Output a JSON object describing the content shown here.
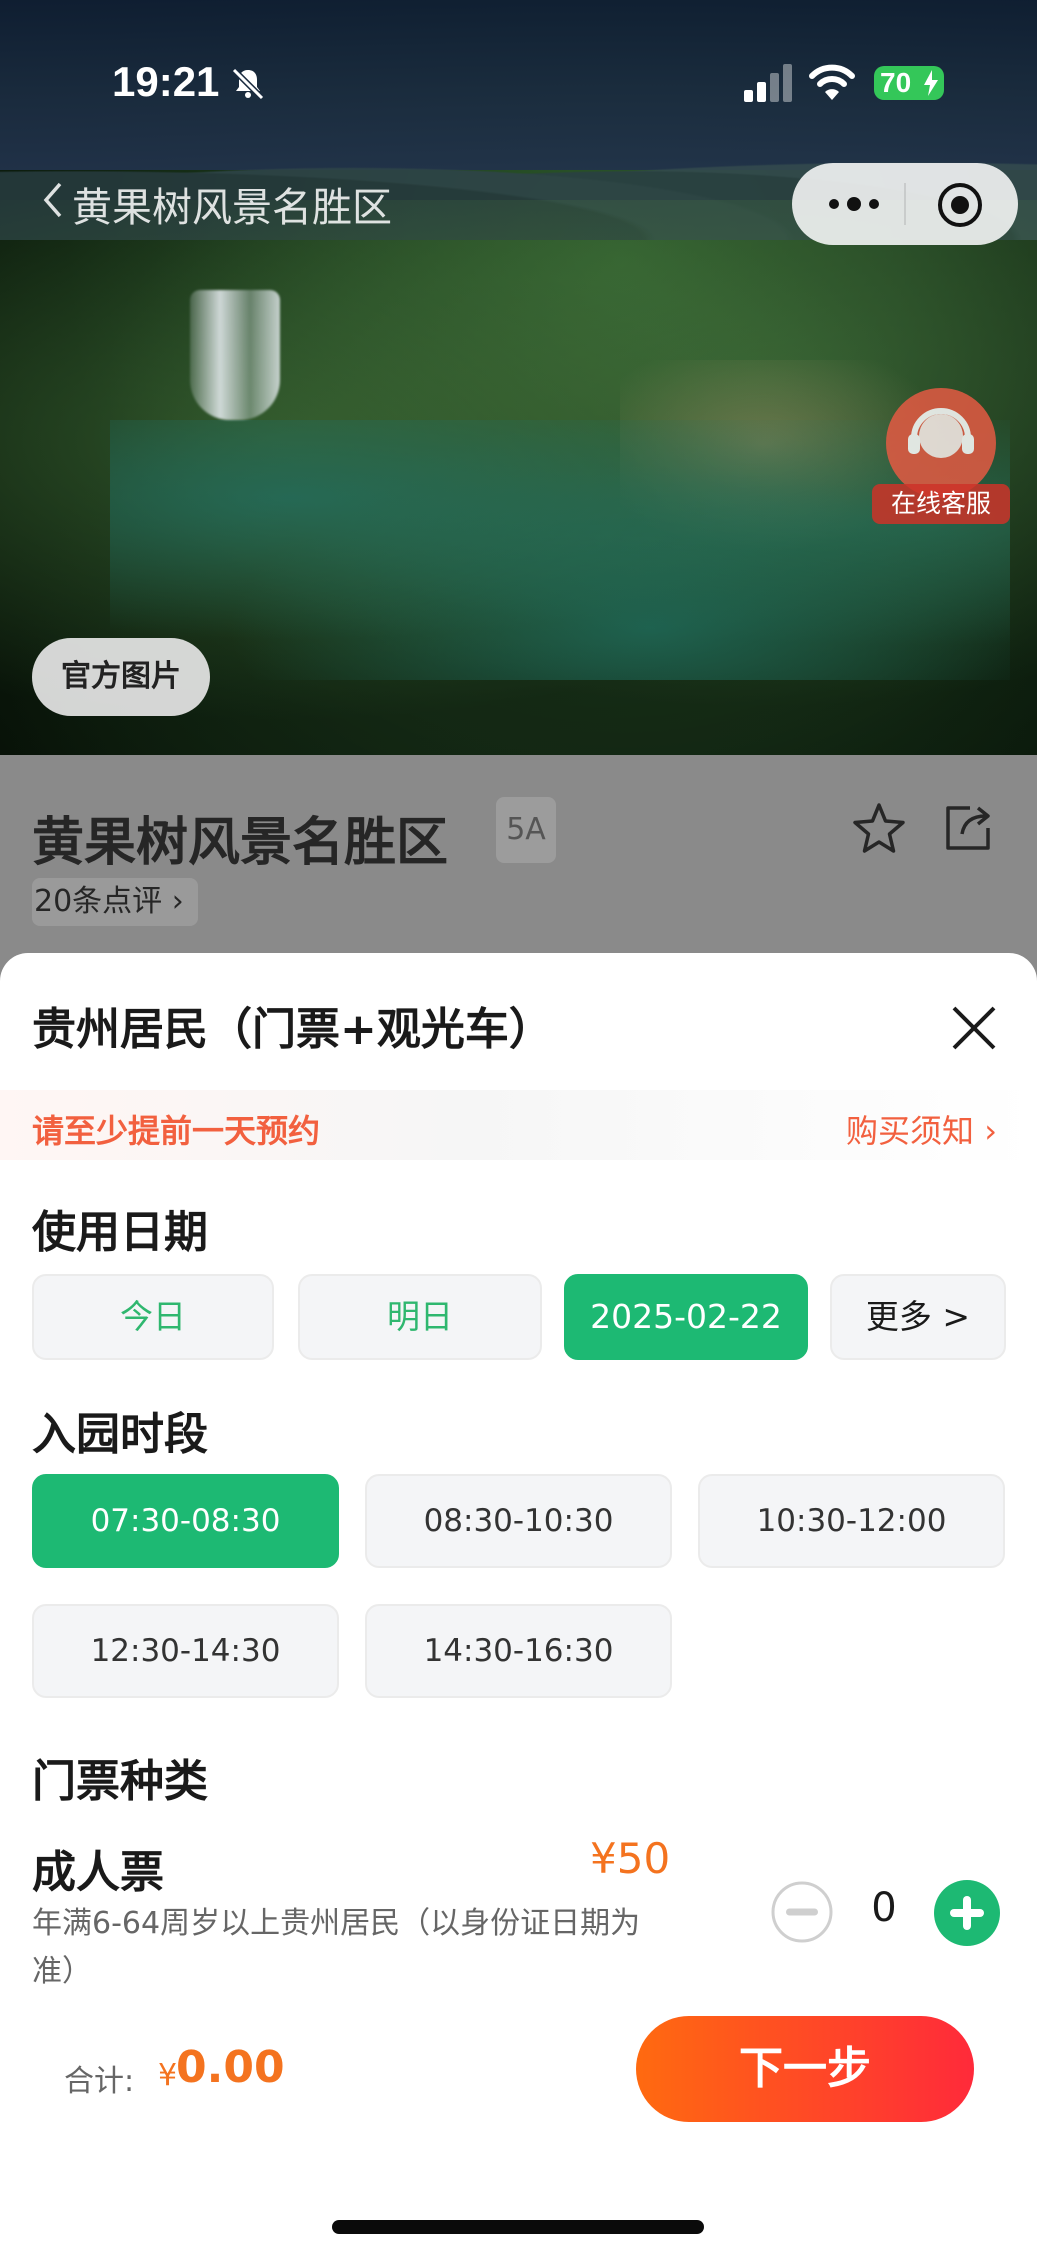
{
  "status_bar": {
    "time": "19:21",
    "battery": "70"
  },
  "nav": {
    "title": "黄果树风景名胜区"
  },
  "hero": {
    "official_pic_label": "官方图片",
    "customer_service_label": "在线客服"
  },
  "spot": {
    "name": "黄果树风景名胜区",
    "level": "5A",
    "reviews": "20条点评"
  },
  "sheet": {
    "title": "贵州居民（门票+观光车）",
    "notice": "请至少提前一天预约",
    "notice_link": "购买须知",
    "date_label": "使用日期",
    "dates": [
      "今日",
      "明日",
      "2025-02-22",
      "更多 >"
    ],
    "selected_date_index": 2,
    "time_label": "入园时段",
    "slots": [
      "07:30-08:30",
      "08:30-10:30",
      "10:30-12:00",
      "12:30-14:30",
      "14:30-16:30"
    ],
    "selected_slot_index": 0,
    "ticket_type_label": "门票种类",
    "ticket": {
      "name": "成人票",
      "price": "¥50",
      "desc": "年满6-64周岁以上贵州居民（以身份证日期为准）",
      "quantity": "0"
    }
  },
  "footer": {
    "total_label": "合计:",
    "currency": "¥",
    "total": "0.00",
    "next_label": "下一步"
  },
  "colors": {
    "green": "#1db973",
    "orange": "#f4731f",
    "notice_red": "#f2603f"
  }
}
